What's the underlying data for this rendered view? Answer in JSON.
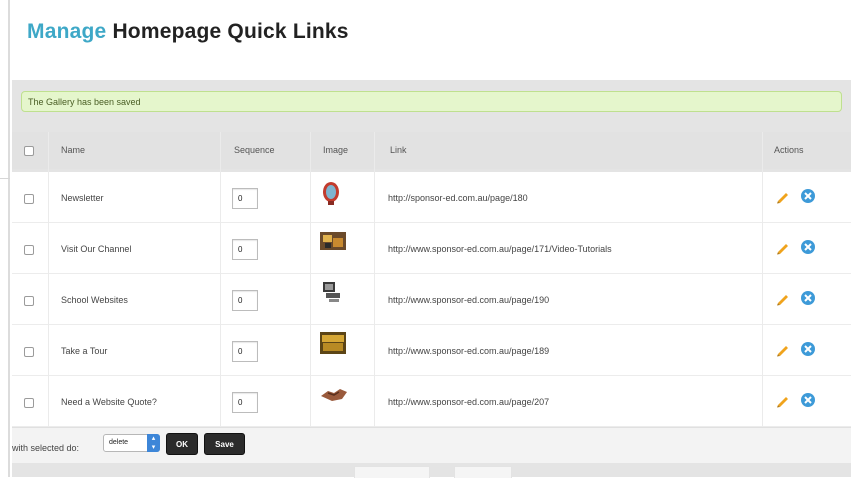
{
  "page": {
    "title_accent": "Manage",
    "title_rest": "Homepage Quick Links"
  },
  "notice": {
    "text": "The Gallery has been saved",
    "color": "#e5f6cc"
  },
  "table": {
    "columns": {
      "name": "Name",
      "sequence": "Sequence",
      "image": "Image",
      "link": "Link",
      "actions": "Actions"
    },
    "rows": [
      {
        "name": "Newsletter",
        "sequence": "0",
        "image_icon": "badge-icon",
        "link": "http://sponsor-ed.com.au/page/180"
      },
      {
        "name": "Visit Our Channel",
        "sequence": "0",
        "image_icon": "video-thumbnail-icon",
        "link": "http://www.sponsor-ed.com.au/page/171/Video-Tutorials"
      },
      {
        "name": "School Websites",
        "sequence": "0",
        "image_icon": "computer-thumbnail-icon",
        "link": "http://www.sponsor-ed.com.au/page/190"
      },
      {
        "name": "Take a Tour",
        "sequence": "0",
        "image_icon": "tour-thumbnail-icon",
        "link": "http://www.sponsor-ed.com.au/page/189"
      },
      {
        "name": "Need a Website Quote?",
        "sequence": "0",
        "image_icon": "handshake-thumbnail-icon",
        "link": "http://www.sponsor-ed.com.au/page/207"
      }
    ],
    "row_actions": [
      "pencil-icon",
      "delete-circle-icon"
    ]
  },
  "footer": {
    "label": "with selected do:",
    "select_value": "delete",
    "ok_label": "OK",
    "save_label": "Save"
  },
  "colors": {
    "accent": "#3ea8c7",
    "delete_icon": "#3d9ad8",
    "edit_icon": "#f0a31c"
  }
}
